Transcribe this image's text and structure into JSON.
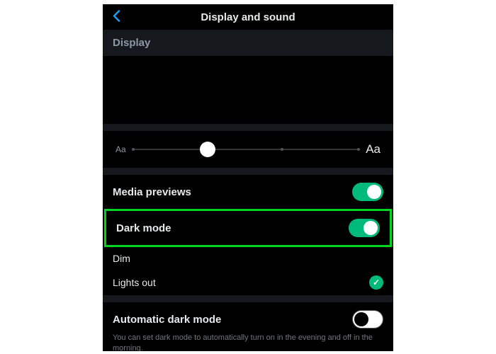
{
  "header": {
    "title": "Display and sound"
  },
  "section": {
    "display": "Display"
  },
  "fontSlider": {
    "small": "Aa",
    "large": "Aa"
  },
  "rows": {
    "mediaPreviews": "Media previews",
    "darkMode": "Dark mode",
    "dim": "Dim",
    "lightsOut": "Lights out",
    "automaticDarkMode": "Automatic dark mode",
    "automaticDesc": "You can set dark mode to automatically turn on in the evening and off in the morning."
  }
}
